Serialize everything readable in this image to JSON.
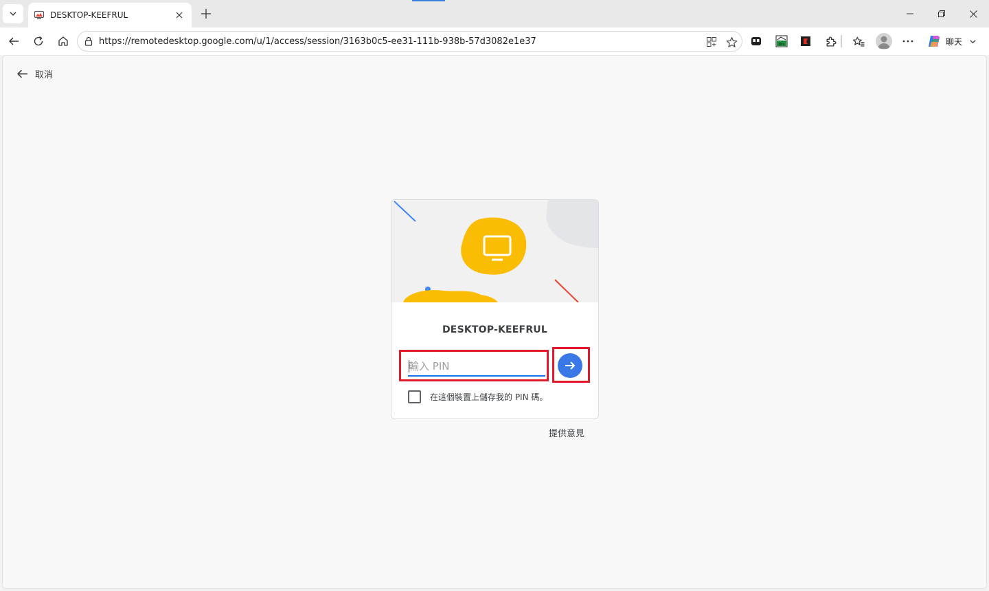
{
  "browser": {
    "tab": {
      "title": "DESKTOP-KEEFRUL"
    },
    "address": {
      "url": "https://remotedesktop.google.com/u/1/access/session/3163b0c5-ee31-111b-938b-57d3082e1e37"
    },
    "copilot_label": "聊天"
  },
  "page": {
    "cancel_label": "取消",
    "card": {
      "host_name": "DESKTOP-KEEFRUL",
      "pin_placeholder": "輸入 PIN",
      "remember_label": "在這個裝置上儲存我的 PIN 碼。",
      "remember_checked": false
    },
    "feedback_label": "提供意見"
  },
  "colors": {
    "accent_blue": "#3b78e7",
    "highlight_red": "#e0192b",
    "illustration_yellow": "#fbbc04",
    "illustration_red": "#ea4335"
  }
}
